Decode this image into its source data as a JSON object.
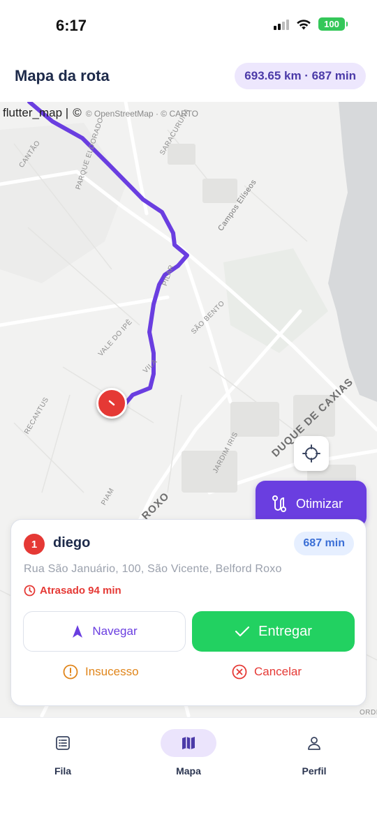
{
  "status_bar": {
    "time": "6:17",
    "battery": "100"
  },
  "header": {
    "title": "Mapa da rota",
    "route_summary": "693.65 km · 687 min"
  },
  "map": {
    "attribution_lib": "flutter_map |",
    "attribution_osm": "© OpenStreetMap · © CARTO",
    "labels": {
      "cantao": "CANTÃO",
      "parque_eldorado": "PARQUE ELDORADO",
      "saracuruna": "SARACURUNA",
      "campos_eliseos": "Campos Elíseos",
      "vale_do_ipe": "VALE DO IPÊ",
      "sao_bento": "SÃO BENTO",
      "recantus": "RECANTUS",
      "duque_de_caxias": "DUQUE DE CAXIAS",
      "jardim_iris": "JARDIM IRIS",
      "piam": "PIAM",
      "roxo": "ROXO",
      "vila": "VILA",
      "pilar": "PILAR",
      "ordi": "ORDI"
    },
    "route_color": "#6a3ee0",
    "marker_color": "#e53935",
    "optimize_label": "Otimizar"
  },
  "stop": {
    "number": "1",
    "name": "diego",
    "eta": "687 min",
    "address": "Rua São Januário, 100, São Vicente, Belford Roxo",
    "late_text": "Atrasado 94 min",
    "navigate_label": "Navegar",
    "deliver_label": "Entregar",
    "fail_label": "Insucesso",
    "cancel_label": "Cancelar"
  },
  "bottom_nav": {
    "items": [
      {
        "label": "Fila",
        "icon": "list-icon"
      },
      {
        "label": "Mapa",
        "icon": "map-icon",
        "active": true
      },
      {
        "label": "Perfil",
        "icon": "person-icon"
      }
    ]
  },
  "colors": {
    "accent": "#6a3ee0",
    "success": "#22d161",
    "danger": "#e53935",
    "warning": "#e0851a",
    "info": "#3b6fd6"
  }
}
